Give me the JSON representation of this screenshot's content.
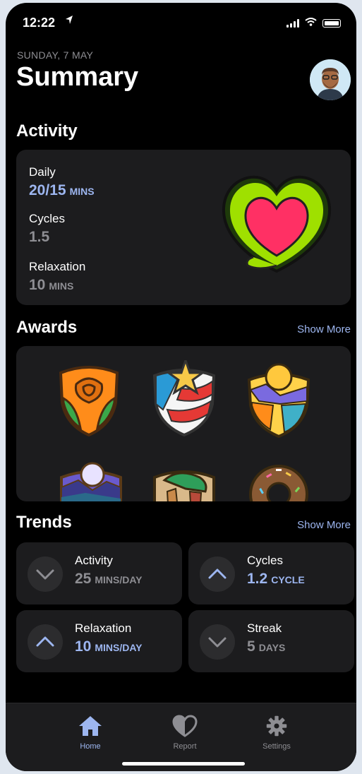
{
  "status": {
    "time": "12:22",
    "arrow": "➤"
  },
  "header": {
    "date": "SUNDAY, 7 MAY",
    "title": "Summary"
  },
  "activity": {
    "title": "Activity",
    "rows": [
      {
        "label": "Daily",
        "value": "20/15",
        "unit": "MINS"
      },
      {
        "label": "Cycles",
        "value": "1.5",
        "unit": ""
      },
      {
        "label": "Relaxation",
        "value": "10",
        "unit": "MINS"
      }
    ]
  },
  "awards": {
    "title": "Awards",
    "show_more": "Show More"
  },
  "trends": {
    "title": "Trends",
    "show_more": "Show More",
    "items": [
      {
        "label": "Activity",
        "value": "25",
        "unit": "MINS/DAY",
        "direction": "down"
      },
      {
        "label": "Cycles",
        "value": "1.2",
        "unit": "CYCLE",
        "direction": "up"
      },
      {
        "label": "Relaxation",
        "value": "10",
        "unit": "MINS/DAY",
        "direction": "up"
      },
      {
        "label": "Streak",
        "value": "5",
        "unit": "DAYS",
        "direction": "down"
      }
    ]
  },
  "tabbar": {
    "items": [
      {
        "label": "Home",
        "icon": "home-icon"
      },
      {
        "label": "Report",
        "icon": "heart-icon"
      },
      {
        "label": "Settings",
        "icon": "gear-icon"
      }
    ]
  },
  "colors": {
    "accent": "#9db6f0",
    "background": "#000000",
    "card": "#1c1c1e"
  }
}
